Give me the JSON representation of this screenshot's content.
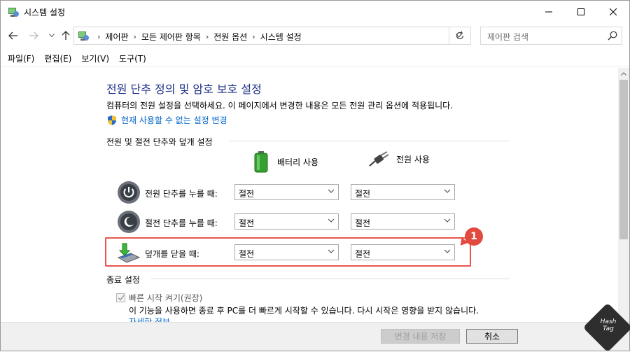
{
  "window": {
    "title": "시스템 설정"
  },
  "address": {
    "crumbs": [
      "제어판",
      "모든 제어판 항목",
      "전원 옵션",
      "시스템 설정"
    ],
    "search_placeholder": "제어판 검색"
  },
  "menu": [
    "파일(F)",
    "편집(E)",
    "보기(V)",
    "도구(T)"
  ],
  "page": {
    "title": "전원 단추 정의 및 암호 보호 설정",
    "description": "컴퓨터의 전원 설정을 선택하세요. 이 페이지에서 변경한 내용은 모든 전원 관리 옵션에 적용됩니다.",
    "change_link": "현재 사용할 수 없는 설정 변경"
  },
  "power_section": {
    "label": "전원 및 절전 단추와 덮개 설정",
    "col_battery": "배터리 사용",
    "col_plugged": "전원 사용",
    "rows": [
      {
        "label": "전원 단추를 누를 때:",
        "battery": "절전",
        "plugged": "절전",
        "icon": "power-button-icon"
      },
      {
        "label": "절전 단추를 누를 때:",
        "battery": "절전",
        "plugged": "절전",
        "icon": "sleep-button-icon"
      },
      {
        "label": "덮개를 닫을 때:",
        "battery": "절전",
        "plugged": "절전",
        "icon": "laptop-lid-icon"
      }
    ]
  },
  "annotation": {
    "badge": "1",
    "color": "#e34a3f"
  },
  "shutdown_section": {
    "label": "종료 설정",
    "fast_startup_label": "빠른 시작 켜기(권장)",
    "fast_startup_checked": true,
    "fast_startup_desc": "이 기능을 사용하면 종료 후 PC를 더 빠르게 시작할 수 있습니다. 다시 시작은 영향을 받지 않습니다.",
    "more_link": "자세한 정보"
  },
  "footer": {
    "save_label": "변경 내용 저장",
    "cancel_label": "취소"
  },
  "watermark": {
    "line1": "Hash",
    "line2": "Tag"
  },
  "colors": {
    "heading": "#1e3287",
    "link": "#0066cc",
    "highlight": "#e8564d"
  }
}
